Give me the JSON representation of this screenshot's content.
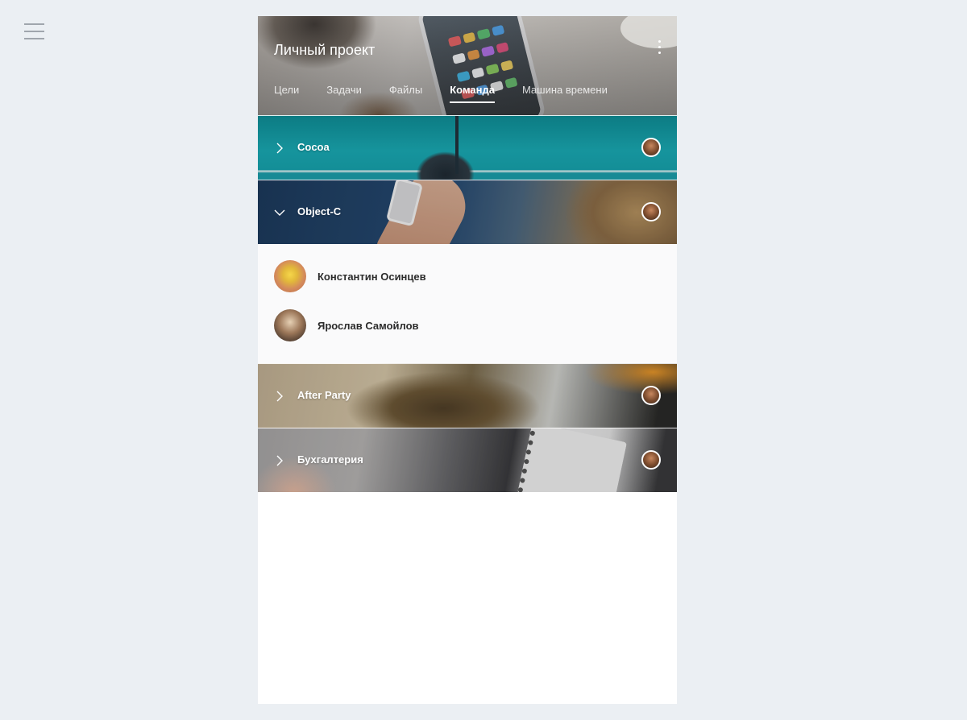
{
  "header": {
    "title": "Личный проект",
    "tabs": [
      {
        "label": "Цели",
        "active": false
      },
      {
        "label": "Задачи",
        "active": false
      },
      {
        "label": "Файлы",
        "active": false
      },
      {
        "label": "Команда",
        "active": true
      },
      {
        "label": "Машина времени",
        "active": false
      }
    ]
  },
  "icons": {
    "menu": "hamburger-menu-icon",
    "more": "more-vertical-icon",
    "collapsed": "chevron-right-icon",
    "expanded": "chevron-down-icon"
  },
  "teams": [
    {
      "label": "Cocoa",
      "expanded": false
    },
    {
      "label": "Object-C",
      "expanded": true,
      "members": [
        {
          "name": "Константин Осинцев"
        },
        {
          "name": "Ярослав Самойлов"
        }
      ]
    },
    {
      "label": "After Party",
      "expanded": false
    },
    {
      "label": "Бухгалтерия",
      "expanded": false
    }
  ],
  "colors": {
    "page_background": "#ebeff3",
    "panel_background": "#ffffff",
    "members_background": "#fafafb",
    "text_dark": "#2b2b2b"
  }
}
